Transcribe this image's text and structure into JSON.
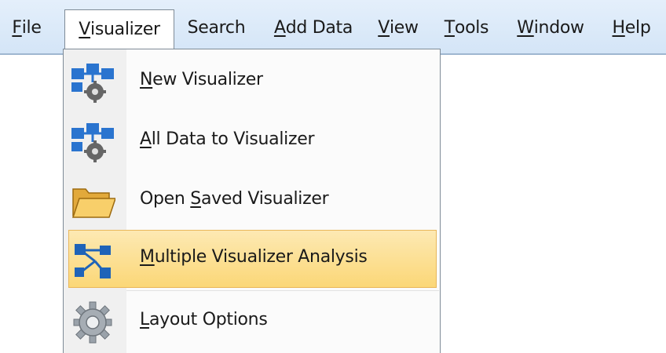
{
  "menubar": {
    "items": [
      {
        "key": "F",
        "rest": "ile"
      },
      {
        "key": "V",
        "rest": "isualizer"
      },
      {
        "key": "",
        "rest": "Search"
      },
      {
        "key": "A",
        "rest": "dd Data"
      },
      {
        "key": "V",
        "rest": "iew"
      },
      {
        "key": "T",
        "rest": "ools"
      },
      {
        "key": "W",
        "rest": "indow"
      },
      {
        "key": "H",
        "rest": "elp"
      }
    ],
    "active": "Visualizer"
  },
  "dropdown": {
    "items": [
      {
        "pre": "",
        "key": "N",
        "rest": "ew Visualizer",
        "icon": "visualizer-network-gear-icon"
      },
      {
        "pre": "",
        "key": "A",
        "rest": "ll Data to Visualizer",
        "icon": "visualizer-network-gear-icon"
      },
      {
        "pre": "Open ",
        "key": "S",
        "rest": "aved Visualizer",
        "icon": "folder-open-icon"
      },
      {
        "pre": "",
        "key": "M",
        "rest": "ultiple Visualizer Analysis",
        "icon": "network-diagram-icon",
        "highlighted": true
      },
      {
        "pre": "",
        "key": "L",
        "rest": "ayout Options",
        "icon": "gear-icon"
      }
    ]
  },
  "colors": {
    "menubar_bg": "#dbe9f8",
    "highlight": "#fbd777",
    "icon_blue": "#1f63b8"
  }
}
